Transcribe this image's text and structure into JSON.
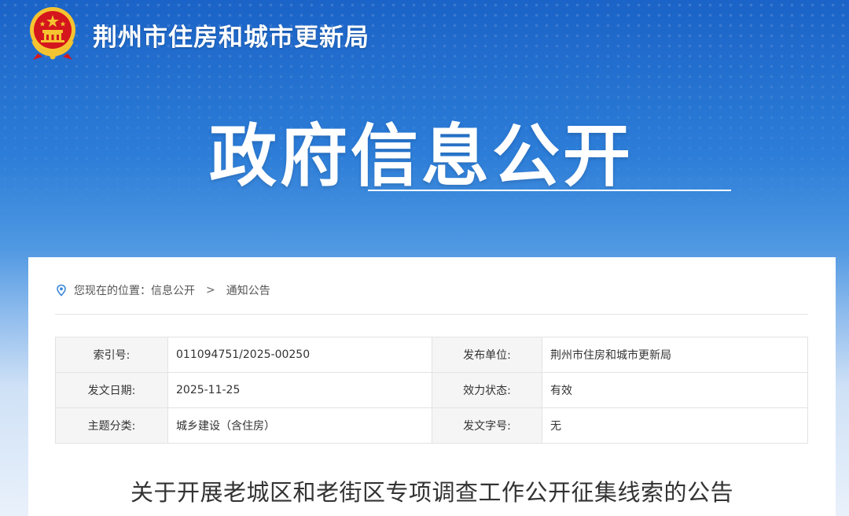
{
  "header": {
    "site_title": "荆州市住房和城市更新局",
    "hero_title": "政府信息公开"
  },
  "breadcrumb": {
    "prefix": "您现在的位置：",
    "items": [
      "信息公开",
      "通知公告"
    ],
    "separator": ">"
  },
  "meta": {
    "rows": [
      {
        "k1": "索引号:",
        "v1": "011094751/2025-00250",
        "k2": "发布单位:",
        "v2": "荆州市住房和城市更新局"
      },
      {
        "k1": "发文日期:",
        "v1": "2025-11-25",
        "k2": "效力状态:",
        "v2": "有效"
      },
      {
        "k1": "主题分类:",
        "v1": "城乡建设（含住房）",
        "k2": "发文字号:",
        "v2": "无"
      }
    ]
  },
  "article": {
    "title": "关于开展老城区和老街区专项调查工作公开征集线索的公告"
  },
  "colors": {
    "banner_blue": "#1b63c7",
    "emblem_red": "#d4161d",
    "emblem_gold": "#f5c430",
    "pin_blue": "#3a87d8"
  }
}
